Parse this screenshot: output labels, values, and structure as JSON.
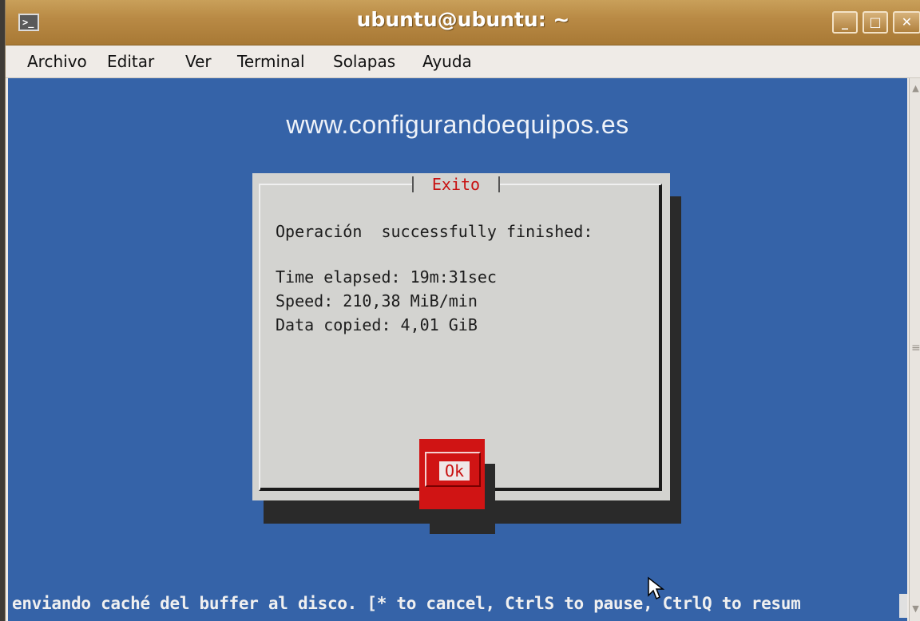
{
  "window": {
    "title": "ubuntu@ubuntu: ~",
    "icon": "terminal-icon",
    "controls": {
      "minimize": "_",
      "maximize": "□",
      "close": "✕"
    }
  },
  "menubar": {
    "items": [
      "Archivo",
      "Editar",
      "Ver",
      "Terminal",
      "Solapas",
      "Ayuda"
    ]
  },
  "terminal": {
    "background": "#3563a8",
    "site_text": "www.configurandoequipos.es",
    "dialog": {
      "title": "Exito",
      "lines": [
        "Operación  successfully finished:",
        "Time elapsed: 19m:31sec",
        "Speed: 210,38 MiB/min",
        "Data copied: 4,01 GiB"
      ],
      "ok_label": "Ok",
      "accent": "#d01414"
    },
    "status_line": "enviando caché del buffer al disco. [* to cancel, CtrlS to pause, CtrlQ to resum"
  }
}
